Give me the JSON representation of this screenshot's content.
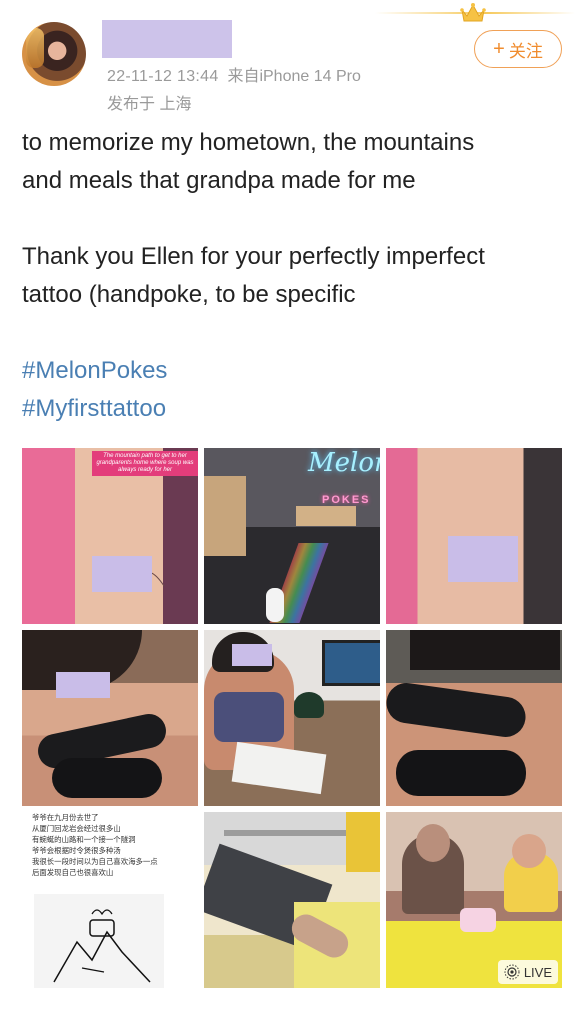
{
  "header": {
    "timestamp": "22-11-12 13:44",
    "source": "来自iPhone 14 Pro",
    "location": "发布于 上海",
    "follow_plus": "+",
    "follow_label": "关注"
  },
  "post": {
    "line1": "to memorize my hometown, the mountains",
    "line2": "and meals that grandpa made for me",
    "line3": "Thank you Ellen for your perfectly imperfect",
    "line4": "tattoo (handpoke, to be specific",
    "hashtag1": "#MelonPokes",
    "hashtag2": "#Myfirsttattoo"
  },
  "gallery": {
    "tile1_caption": "The mountain path to get to her grandparents home where soup was always ready for her",
    "tile2_sign": "Melon",
    "tile2_sign_sub": "POKES",
    "tile7_text": [
      "爷爷在九月份去世了",
      "从厦门回龙岩会经过很多山",
      "有蜿蜒的山路和一个接一个隧洞",
      "爷爷会根据时令煲很多种汤",
      "我很长一段时间以为自己喜欢海多一点",
      "后面发现自己也很喜欢山"
    ],
    "tile9_badge": "LIVE"
  },
  "colors": {
    "accent": "#f08c2e",
    "hashtag": "#4a7fb3",
    "meta": "#9a9a9a",
    "mask": "#cdc3ea"
  }
}
